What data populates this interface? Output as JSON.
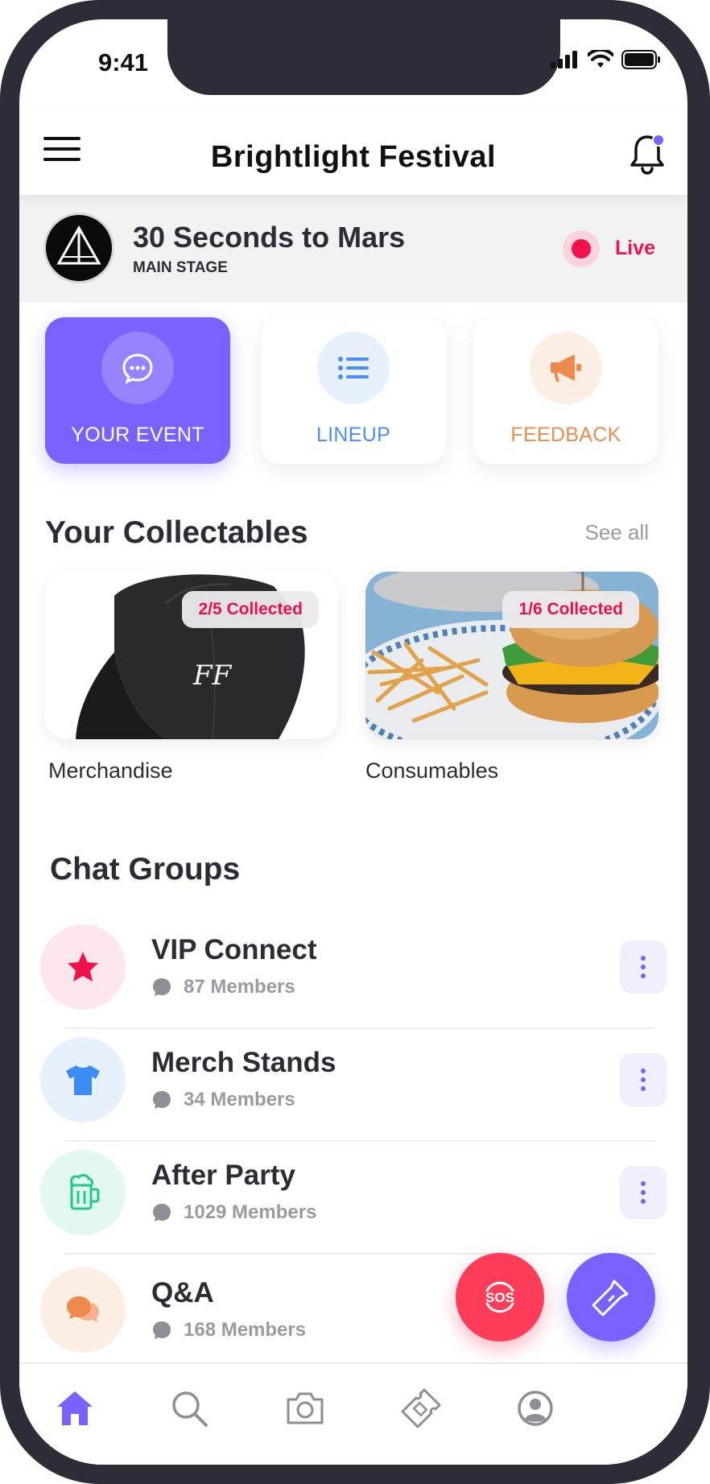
{
  "status_bar": {
    "time": "9:41"
  },
  "header": {
    "title": "Brightlight Festival"
  },
  "now_playing": {
    "artist": "30 Seconds to Mars",
    "stage": "MAIN STAGE",
    "status": "Live"
  },
  "quick_actions": [
    {
      "label": "YOUR EVENT",
      "icon": "chat-bubble-icon",
      "active": true
    },
    {
      "label": "LINEUP",
      "icon": "list-icon",
      "active": false
    },
    {
      "label": "FEEDBACK",
      "icon": "megaphone-icon",
      "active": false
    }
  ],
  "collectables": {
    "title": "Your Collectables",
    "see_all": "See all",
    "items": [
      {
        "label": "Merchandise",
        "badge": "2/5 Collected",
        "image": "cap-photo"
      },
      {
        "label": "Consumables",
        "badge": "1/6 Collected",
        "image": "burger-photo"
      }
    ]
  },
  "chat_groups": {
    "title": "Chat Groups",
    "items": [
      {
        "name": "VIP Connect",
        "members": "87 Members",
        "icon": "star-icon",
        "color": "#f2104d",
        "bg": "#fde6ec"
      },
      {
        "name": "Merch Stands",
        "members": "34 Members",
        "icon": "tshirt-icon",
        "color": "#3b8cf5",
        "bg": "#e7f1fd"
      },
      {
        "name": "After Party",
        "members": "1029 Members",
        "icon": "beer-mug-icon",
        "color": "#1fc98f",
        "bg": "#e3f9f0"
      },
      {
        "name": "Q&A",
        "members": "168 Members",
        "icon": "speech-bubbles-icon",
        "color": "#ef8a4e",
        "bg": "#fdeee4"
      }
    ]
  },
  "fabs": {
    "sos": "sos-icon",
    "torch": "flashlight-icon"
  },
  "bottom_nav": [
    "home-icon",
    "search-icon",
    "camera-icon",
    "ticket-icon",
    "profile-icon"
  ],
  "colors": {
    "accent": "#7b61ff",
    "live": "#f2104d",
    "lineup": "#4a8df6",
    "feedback": "#ef8a4e"
  }
}
